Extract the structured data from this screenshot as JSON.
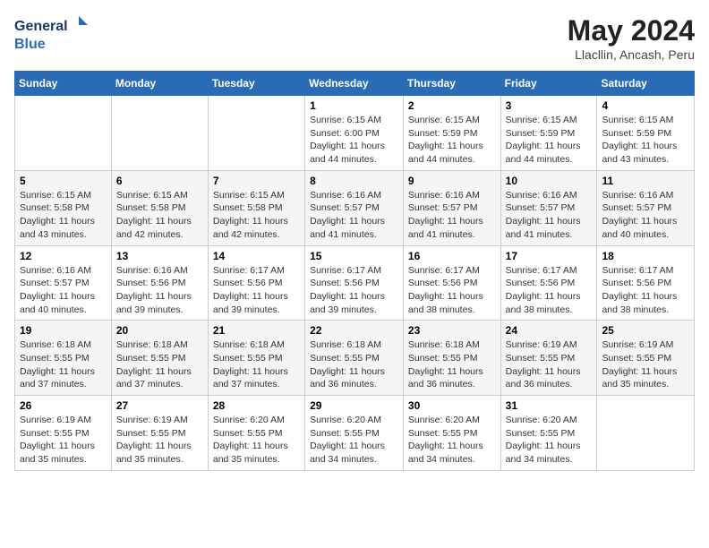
{
  "logo": {
    "line1": "General",
    "line2": "Blue"
  },
  "title": "May 2024",
  "location": "Llacllin, Ancash, Peru",
  "weekdays": [
    "Sunday",
    "Monday",
    "Tuesday",
    "Wednesday",
    "Thursday",
    "Friday",
    "Saturday"
  ],
  "weeks": [
    [
      {
        "day": "",
        "content": ""
      },
      {
        "day": "",
        "content": ""
      },
      {
        "day": "",
        "content": ""
      },
      {
        "day": "1",
        "content": "Sunrise: 6:15 AM\nSunset: 6:00 PM\nDaylight: 11 hours\nand 44 minutes."
      },
      {
        "day": "2",
        "content": "Sunrise: 6:15 AM\nSunset: 5:59 PM\nDaylight: 11 hours\nand 44 minutes."
      },
      {
        "day": "3",
        "content": "Sunrise: 6:15 AM\nSunset: 5:59 PM\nDaylight: 11 hours\nand 44 minutes."
      },
      {
        "day": "4",
        "content": "Sunrise: 6:15 AM\nSunset: 5:59 PM\nDaylight: 11 hours\nand 43 minutes."
      }
    ],
    [
      {
        "day": "5",
        "content": "Sunrise: 6:15 AM\nSunset: 5:58 PM\nDaylight: 11 hours\nand 43 minutes."
      },
      {
        "day": "6",
        "content": "Sunrise: 6:15 AM\nSunset: 5:58 PM\nDaylight: 11 hours\nand 42 minutes."
      },
      {
        "day": "7",
        "content": "Sunrise: 6:15 AM\nSunset: 5:58 PM\nDaylight: 11 hours\nand 42 minutes."
      },
      {
        "day": "8",
        "content": "Sunrise: 6:16 AM\nSunset: 5:57 PM\nDaylight: 11 hours\nand 41 minutes."
      },
      {
        "day": "9",
        "content": "Sunrise: 6:16 AM\nSunset: 5:57 PM\nDaylight: 11 hours\nand 41 minutes."
      },
      {
        "day": "10",
        "content": "Sunrise: 6:16 AM\nSunset: 5:57 PM\nDaylight: 11 hours\nand 41 minutes."
      },
      {
        "day": "11",
        "content": "Sunrise: 6:16 AM\nSunset: 5:57 PM\nDaylight: 11 hours\nand 40 minutes."
      }
    ],
    [
      {
        "day": "12",
        "content": "Sunrise: 6:16 AM\nSunset: 5:57 PM\nDaylight: 11 hours\nand 40 minutes."
      },
      {
        "day": "13",
        "content": "Sunrise: 6:16 AM\nSunset: 5:56 PM\nDaylight: 11 hours\nand 39 minutes."
      },
      {
        "day": "14",
        "content": "Sunrise: 6:17 AM\nSunset: 5:56 PM\nDaylight: 11 hours\nand 39 minutes."
      },
      {
        "day": "15",
        "content": "Sunrise: 6:17 AM\nSunset: 5:56 PM\nDaylight: 11 hours\nand 39 minutes."
      },
      {
        "day": "16",
        "content": "Sunrise: 6:17 AM\nSunset: 5:56 PM\nDaylight: 11 hours\nand 38 minutes."
      },
      {
        "day": "17",
        "content": "Sunrise: 6:17 AM\nSunset: 5:56 PM\nDaylight: 11 hours\nand 38 minutes."
      },
      {
        "day": "18",
        "content": "Sunrise: 6:17 AM\nSunset: 5:56 PM\nDaylight: 11 hours\nand 38 minutes."
      }
    ],
    [
      {
        "day": "19",
        "content": "Sunrise: 6:18 AM\nSunset: 5:55 PM\nDaylight: 11 hours\nand 37 minutes."
      },
      {
        "day": "20",
        "content": "Sunrise: 6:18 AM\nSunset: 5:55 PM\nDaylight: 11 hours\nand 37 minutes."
      },
      {
        "day": "21",
        "content": "Sunrise: 6:18 AM\nSunset: 5:55 PM\nDaylight: 11 hours\nand 37 minutes."
      },
      {
        "day": "22",
        "content": "Sunrise: 6:18 AM\nSunset: 5:55 PM\nDaylight: 11 hours\nand 36 minutes."
      },
      {
        "day": "23",
        "content": "Sunrise: 6:18 AM\nSunset: 5:55 PM\nDaylight: 11 hours\nand 36 minutes."
      },
      {
        "day": "24",
        "content": "Sunrise: 6:19 AM\nSunset: 5:55 PM\nDaylight: 11 hours\nand 36 minutes."
      },
      {
        "day": "25",
        "content": "Sunrise: 6:19 AM\nSunset: 5:55 PM\nDaylight: 11 hours\nand 35 minutes."
      }
    ],
    [
      {
        "day": "26",
        "content": "Sunrise: 6:19 AM\nSunset: 5:55 PM\nDaylight: 11 hours\nand 35 minutes."
      },
      {
        "day": "27",
        "content": "Sunrise: 6:19 AM\nSunset: 5:55 PM\nDaylight: 11 hours\nand 35 minutes."
      },
      {
        "day": "28",
        "content": "Sunrise: 6:20 AM\nSunset: 5:55 PM\nDaylight: 11 hours\nand 35 minutes."
      },
      {
        "day": "29",
        "content": "Sunrise: 6:20 AM\nSunset: 5:55 PM\nDaylight: 11 hours\nand 34 minutes."
      },
      {
        "day": "30",
        "content": "Sunrise: 6:20 AM\nSunset: 5:55 PM\nDaylight: 11 hours\nand 34 minutes."
      },
      {
        "day": "31",
        "content": "Sunrise: 6:20 AM\nSunset: 5:55 PM\nDaylight: 11 hours\nand 34 minutes."
      },
      {
        "day": "",
        "content": ""
      }
    ]
  ]
}
